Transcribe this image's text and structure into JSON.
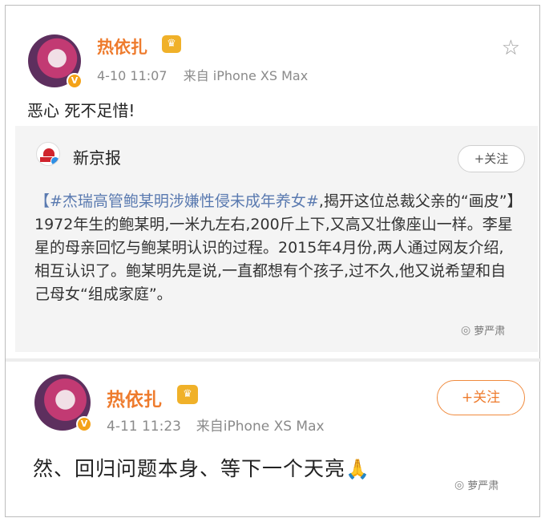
{
  "post1": {
    "username": "热依扎",
    "time": "4-10 11:07",
    "source": "来自 iPhone XS Max",
    "text": "恶心 死不足惜!",
    "icons": {
      "crown": "vip-crown-icon",
      "star": "star-outline-icon",
      "verified": "verified-v-icon"
    }
  },
  "repost": {
    "account": "新京报",
    "follow_label": "+关注",
    "hashtag": "【#杰瑞高管鲍某明涉嫌性侵未成年养女#",
    "body": ",揭开这位总裁父亲的“画皮”】1972年生的鲍某明,一米九左右,200斤上下,又高又壮像座山一样。李星星的母亲回忆与鲍某明认识的过程。2015年4月份,两人通过网友介绍,相互认识了。鲍某明先是说,一直都想有个孩子,过不久,他又说希望和自己母女“组成家庭”。",
    "watermark": "萝严肃"
  },
  "post2": {
    "username": "热依扎",
    "time": "4-11 11:23",
    "source": "来自iPhone XS Max",
    "follow_label": "+关注",
    "text": "然、回归问题本身、等下一个天亮",
    "watermark": "萝严肃"
  },
  "colors": {
    "username": "#ee7b2d",
    "meta": "#8a8a8a",
    "hashtag": "#5a7ab0",
    "repost_bg": "#f4f4f4",
    "follow_border": "#f08b3e"
  }
}
